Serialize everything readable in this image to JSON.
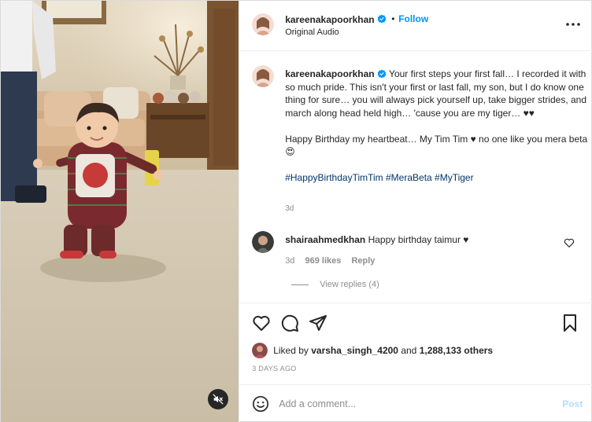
{
  "post": {
    "username": "kareenakapoorkhan",
    "follow_label": "Follow",
    "dot": "•",
    "audio": "Original Audio"
  },
  "caption": {
    "username": "kareenakapoorkhan",
    "text": "Your first steps your first fall… I recorded it with so much pride. This isn't your first or last fall, my son, but I do know one thing for sure… you will always pick yourself up, take bigger strides, and march along head held high… 'cause you are my tiger… ♥♥",
    "birthday_line": "Happy Birthday my heartbeat… My Tim Tim ♥ no one like you mera beta 😍",
    "hashtags": "#HappyBirthdayTimTim #MeraBeta #MyTiger",
    "time_ago": "3d"
  },
  "comment": {
    "username": "shairaahmedkhan",
    "text": "Happy birthday taimur ♥",
    "time_ago": "3d",
    "likes": "969 likes",
    "reply_label": "Reply",
    "view_replies": "View replies (4)"
  },
  "likes": {
    "prefix": "Liked by",
    "user": "varsha_singh_4200",
    "and": "and",
    "others": "1,288,133 others"
  },
  "date": "3 DAYS AGO",
  "add_comment": {
    "placeholder": "Add a comment...",
    "post_label": "Post"
  },
  "icons": {
    "verified": "verified-badge-icon",
    "more": "more-options-icon",
    "like": "heart-icon",
    "comment": "comment-icon",
    "share": "paper-plane-icon",
    "save": "bookmark-icon",
    "emoji": "smiley-icon",
    "mute": "speaker-muted-icon"
  },
  "colors": {
    "accent": "#0095f6",
    "hashtag": "#00376b",
    "muted": "#8e8e8e",
    "post_disabled": "#b2dffc"
  }
}
